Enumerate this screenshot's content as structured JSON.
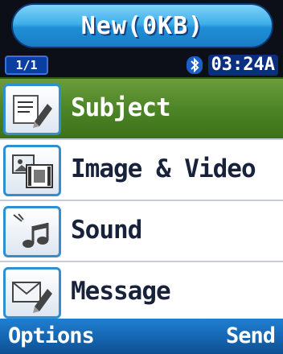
{
  "header": {
    "title": "New(0KB)"
  },
  "status": {
    "page_indicator": "1/1",
    "time": "03:24A",
    "bluetooth_icon": "bluetooth-icon"
  },
  "menu": {
    "items": [
      {
        "label": "Subject",
        "icon": "subject-edit-icon",
        "selected": true
      },
      {
        "label": "Image & Video",
        "icon": "image-video-icon",
        "selected": false
      },
      {
        "label": "Sound",
        "icon": "sound-icon",
        "selected": false
      },
      {
        "label": "Message",
        "icon": "message-edit-icon",
        "selected": false
      }
    ]
  },
  "softkeys": {
    "left_label": "Options",
    "right_label": "Send"
  },
  "colors": {
    "selected_row": "#4d8526",
    "title_bar": "#3fb0ea",
    "softkey_bar": "#1463ad"
  }
}
